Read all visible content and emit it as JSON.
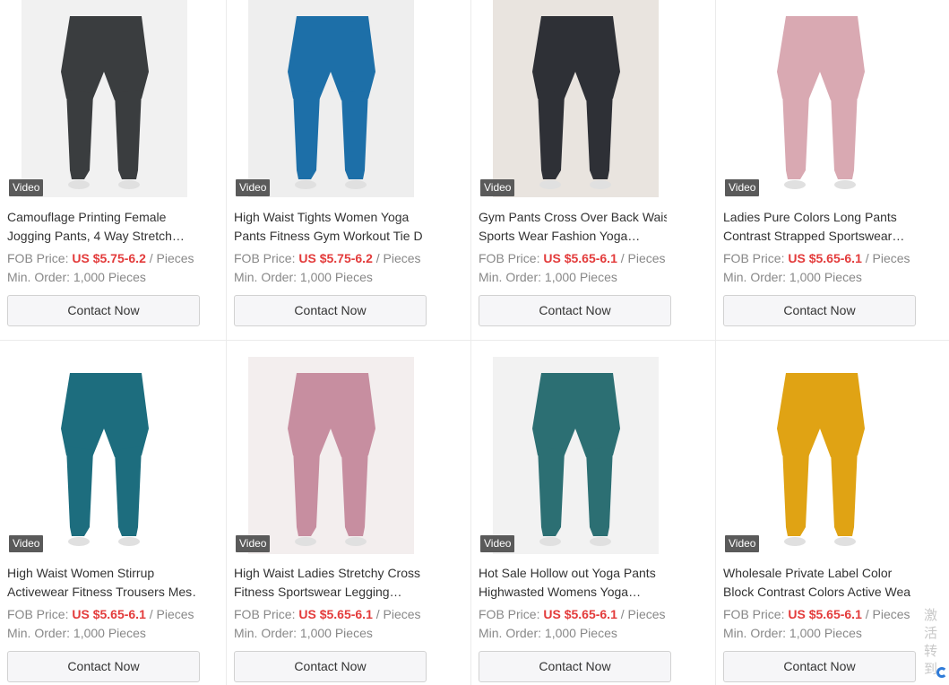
{
  "products": [
    {
      "title_line1": "Camouflage Printing Female",
      "title_line2": "Jogging Pants, 4 Way Stretch…",
      "fob_label": "FOB Price: ",
      "price": "US $5.75-6.2",
      "unit": " / Pieces",
      "moq_label": "Min. Order: ",
      "moq": "1,000 Pieces",
      "badge": "Video",
      "button": "Contact Now",
      "color": "#3a3d3f",
      "bg": "#f1f1f1"
    },
    {
      "title_line1": "High Waist Tights Women Yoga",
      "title_line2": "Pants Fitness Gym Workout Tie D…",
      "fob_label": "FOB Price: ",
      "price": "US $5.75-6.2",
      "unit": " / Pieces",
      "moq_label": "Min. Order: ",
      "moq": "1,000 Pieces",
      "badge": "Video",
      "button": "Contact Now",
      "color": "#1d6fa8",
      "bg": "#eeeeee"
    },
    {
      "title_line1": "Gym Pants Cross Over Back Waist",
      "title_line2": "Sports Wear Fashion Yoga…",
      "fob_label": "FOB Price: ",
      "price": "US $5.65-6.1",
      "unit": " / Pieces",
      "moq_label": "Min. Order: ",
      "moq": "1,000 Pieces",
      "badge": "Video",
      "button": "Contact Now",
      "color": "#2e3036",
      "bg": "#e9e4df"
    },
    {
      "title_line1": "Ladies Pure Colors Long Pants",
      "title_line2": "Contrast Strapped Sportswear…",
      "fob_label": "FOB Price: ",
      "price": "US $5.65-6.1",
      "unit": " / Pieces",
      "moq_label": "Min. Order: ",
      "moq": "1,000 Pieces",
      "badge": "Video",
      "button": "Contact Now",
      "color": "#d9a9b2",
      "bg": "#ffffff"
    },
    {
      "title_line1": "High Waist Women Stirrup",
      "title_line2": "Activewear Fitness Trousers Mes…",
      "fob_label": "FOB Price: ",
      "price": "US $5.65-6.1",
      "unit": " / Pieces",
      "moq_label": "Min. Order: ",
      "moq": "1,000 Pieces",
      "badge": "Video",
      "button": "Contact Now",
      "color": "#1d6d7e",
      "bg": "#ffffff"
    },
    {
      "title_line1": "High Waist Ladies Stretchy Cross",
      "title_line2": "Fitness Sportswear Legging…",
      "fob_label": "FOB Price: ",
      "price": "US $5.65-6.1",
      "unit": " / Pieces",
      "moq_label": "Min. Order: ",
      "moq": "1,000 Pieces",
      "badge": "Video",
      "button": "Contact Now",
      "color": "#c78ea0",
      "bg": "#f3eeee"
    },
    {
      "title_line1": "Hot Sale Hollow out Yoga Pants",
      "title_line2": "Highwasted Womens Yoga…",
      "fob_label": "FOB Price: ",
      "price": "US $5.65-6.1",
      "unit": " / Pieces",
      "moq_label": "Min. Order: ",
      "moq": "1,000 Pieces",
      "badge": "Video",
      "button": "Contact Now",
      "color": "#2c6f73",
      "bg": "#f2f2f2"
    },
    {
      "title_line1": "Wholesale Private Label Color",
      "title_line2": "Block Contrast Colors Active Wea…",
      "fob_label": "FOB Price: ",
      "price": "US $5.65-6.1",
      "unit": " / Pieces",
      "moq_label": "Min. Order: ",
      "moq": "1,000 Pieces",
      "badge": "Video",
      "button": "Contact Now",
      "color": "#e0a314",
      "bg": "#ffffff"
    }
  ],
  "watermark": {
    "line1": "激活",
    "line2": "转到"
  }
}
